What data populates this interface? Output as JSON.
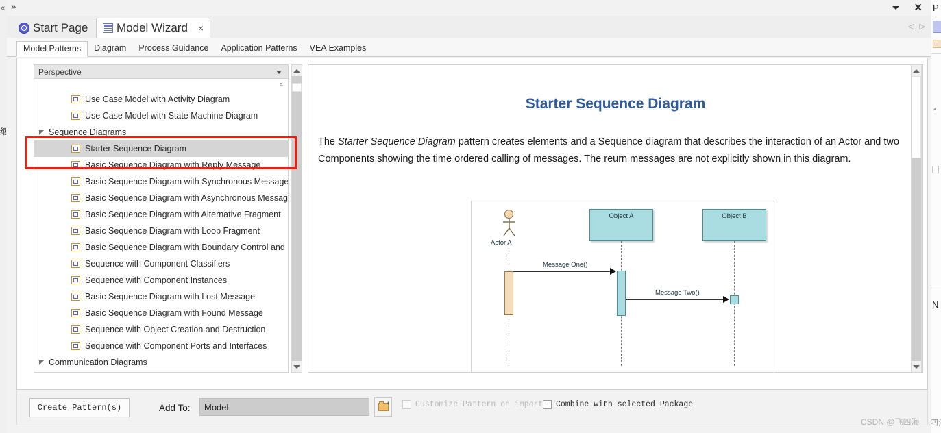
{
  "window": {
    "overflow_chevron": "»",
    "caret_icon": "caret-down",
    "close_icon": "✕"
  },
  "doc_tabs": [
    {
      "label": "Start Page",
      "icon": "start-page-icon",
      "active": false,
      "closable": false
    },
    {
      "label": "Model Wizard",
      "icon": "model-wizard-icon",
      "active": true,
      "closable": true,
      "close_glyph": "×"
    }
  ],
  "tab_nav": {
    "prev": "◁",
    "next": "▷"
  },
  "sub_tabs": [
    {
      "label": "Model Patterns",
      "active": true
    },
    {
      "label": "Diagram",
      "active": false
    },
    {
      "label": "Process Guidance",
      "active": false
    },
    {
      "label": "Application Patterns",
      "active": false
    },
    {
      "label": "VEA Examples",
      "active": false
    }
  ],
  "tree_panel": {
    "perspective_label": "Perspective",
    "search_placeholder": "",
    "search_icon": "search-icon",
    "items": [
      {
        "type": "leaf",
        "label": "Use Case Model with Activity Diagram",
        "selected": false
      },
      {
        "type": "leaf",
        "label": "Use Case Model with State Machine Diagram",
        "selected": false
      },
      {
        "type": "group",
        "label": "Sequence Diagrams",
        "expanded": true
      },
      {
        "type": "leaf",
        "label": "Starter Sequence Diagram",
        "selected": true
      },
      {
        "type": "leaf",
        "label": "Basic Sequence Diagram with Reply Message",
        "selected": false
      },
      {
        "type": "leaf",
        "label": "Basic Sequence Diagram with Synchronous Message",
        "selected": false
      },
      {
        "type": "leaf",
        "label": "Basic Sequence Diagram with Asynchronous Message",
        "selected": false
      },
      {
        "type": "leaf",
        "label": "Basic Sequence Diagram with Alternative Fragment",
        "selected": false
      },
      {
        "type": "leaf",
        "label": "Basic Sequence Diagram with Loop Fragment",
        "selected": false
      },
      {
        "type": "leaf",
        "label": "Basic Sequence Diagram with Boundary Control and Entity",
        "selected": false
      },
      {
        "type": "leaf",
        "label": "Sequence with Component Classifiers",
        "selected": false
      },
      {
        "type": "leaf",
        "label": "Sequence with Component Instances",
        "selected": false
      },
      {
        "type": "leaf",
        "label": "Basic Sequence Diagram with Lost Message",
        "selected": false
      },
      {
        "type": "leaf",
        "label": "Basic Sequence Diagram with Found Message",
        "selected": false
      },
      {
        "type": "leaf",
        "label": "Sequence with Object Creation and Destruction",
        "selected": false
      },
      {
        "type": "leaf",
        "label": "Sequence with Component Ports and Interfaces",
        "selected": false
      },
      {
        "type": "group",
        "label": "Communication Diagrams",
        "expanded": true
      }
    ]
  },
  "content": {
    "title": "Starter Sequence Diagram",
    "description_parts": [
      "The ",
      "Starter Sequence Diagram",
      " pattern creates elements and a Sequence diagram that describes the interaction of an Actor and two Components showing the time ordered calling of messages. The reurn messages are not explicitly shown in this diagram."
    ],
    "diagram": {
      "actor": {
        "name": "Actor A"
      },
      "objects": [
        {
          "name": "Object A"
        },
        {
          "name": "Object B"
        }
      ],
      "messages": [
        {
          "label": "Message One()",
          "from": "Actor A",
          "to": "Object A"
        },
        {
          "label": "Message Two()",
          "from": "Object A",
          "to": "Object B"
        }
      ],
      "colors": {
        "object_fill": "#aadde1",
        "object_border": "#4a8f96",
        "actor_fill": "#f6d9b0",
        "actor_activation": "#f3dcba"
      }
    }
  },
  "bottom_bar": {
    "create_button": "Create Pattern(s)",
    "add_to_label": "Add To:",
    "add_to_value": "Model",
    "folder_icon": "open-folder-icon",
    "checkbox_customize": {
      "label": "Customize Pattern on import",
      "checked": false,
      "disabled": true
    },
    "checkbox_combine": {
      "label": "Combine with selected Package",
      "checked": false,
      "disabled": false
    }
  },
  "watermark": "CSDN @飞四海",
  "left_strip": {
    "chevron": "«",
    "fragment": "缩"
  },
  "right_strip": {
    "head": "P",
    "label": "N",
    "fragment": "四海"
  },
  "accent_colors": {
    "title_blue": "#2e5b9b",
    "highlight_red": "#f81b0a",
    "selection_gray": "#d5d5d5"
  }
}
